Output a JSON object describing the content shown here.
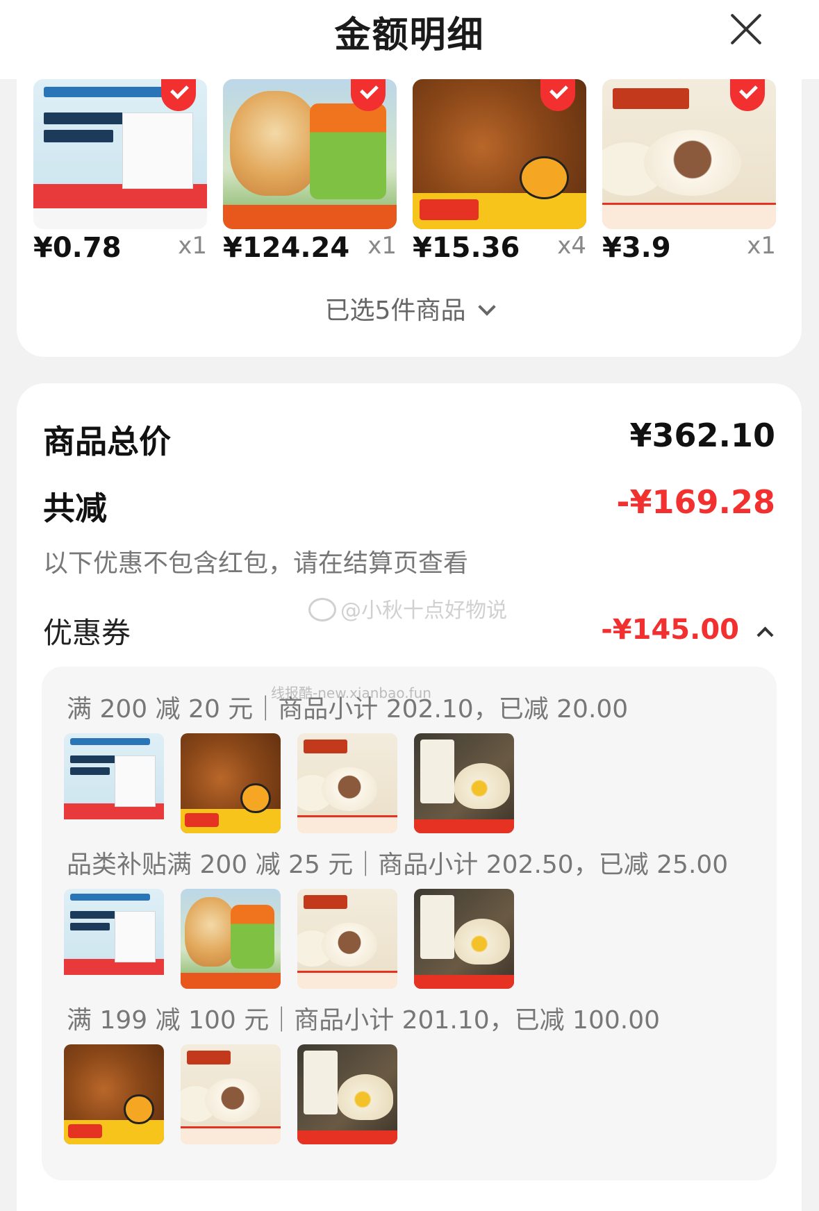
{
  "header": {
    "title": "金额明细"
  },
  "products": [
    {
      "price": "¥0.78",
      "qty": "x1",
      "thumb_icon": "medical-bandage-image"
    },
    {
      "price": "¥124.24",
      "qty": "x1",
      "thumb_icon": "dog-supplement-image"
    },
    {
      "price": "¥15.36",
      "qty": "x4",
      "thumb_icon": "braised-rice-image"
    },
    {
      "price": "¥3.9",
      "qty": "x1",
      "thumb_icon": "steamed-bun-image"
    }
  ],
  "selected_summary": "已选5件商品",
  "summary": {
    "total_label": "商品总价",
    "total_value": "¥362.10",
    "reduce_label": "共减",
    "reduce_value": "-¥169.28",
    "note": "以下优惠不包含红包，请在结算页查看",
    "coupon_label": "优惠券",
    "coupon_value": "-¥145.00"
  },
  "watermarks": {
    "weibo": "@小秋十点好物说",
    "site": "线报酷-new.xianbao.fun"
  },
  "coupons": [
    {
      "condition": "满 200 减 20 元｜商品小计 202.10，已减 20.00",
      "items": [
        "medical-bandage-image",
        "braised-rice-image",
        "steamed-bun-image",
        "dumpling-image"
      ]
    },
    {
      "condition": "品类补贴满 200 减 25 元｜商品小计 202.50，已减 25.00",
      "items": [
        "medical-bandage-image",
        "dog-supplement-image",
        "steamed-bun-image",
        "dumpling-image"
      ]
    },
    {
      "condition": "满 199 减 100 元｜商品小计 201.10，已减 100.00",
      "items": [
        "braised-rice-image",
        "steamed-bun-image",
        "dumpling-image"
      ]
    }
  ],
  "colors": {
    "accent_red": "#f23030",
    "text_dark": "#111111",
    "muted": "#777777",
    "panel": "#f6f6f6"
  }
}
